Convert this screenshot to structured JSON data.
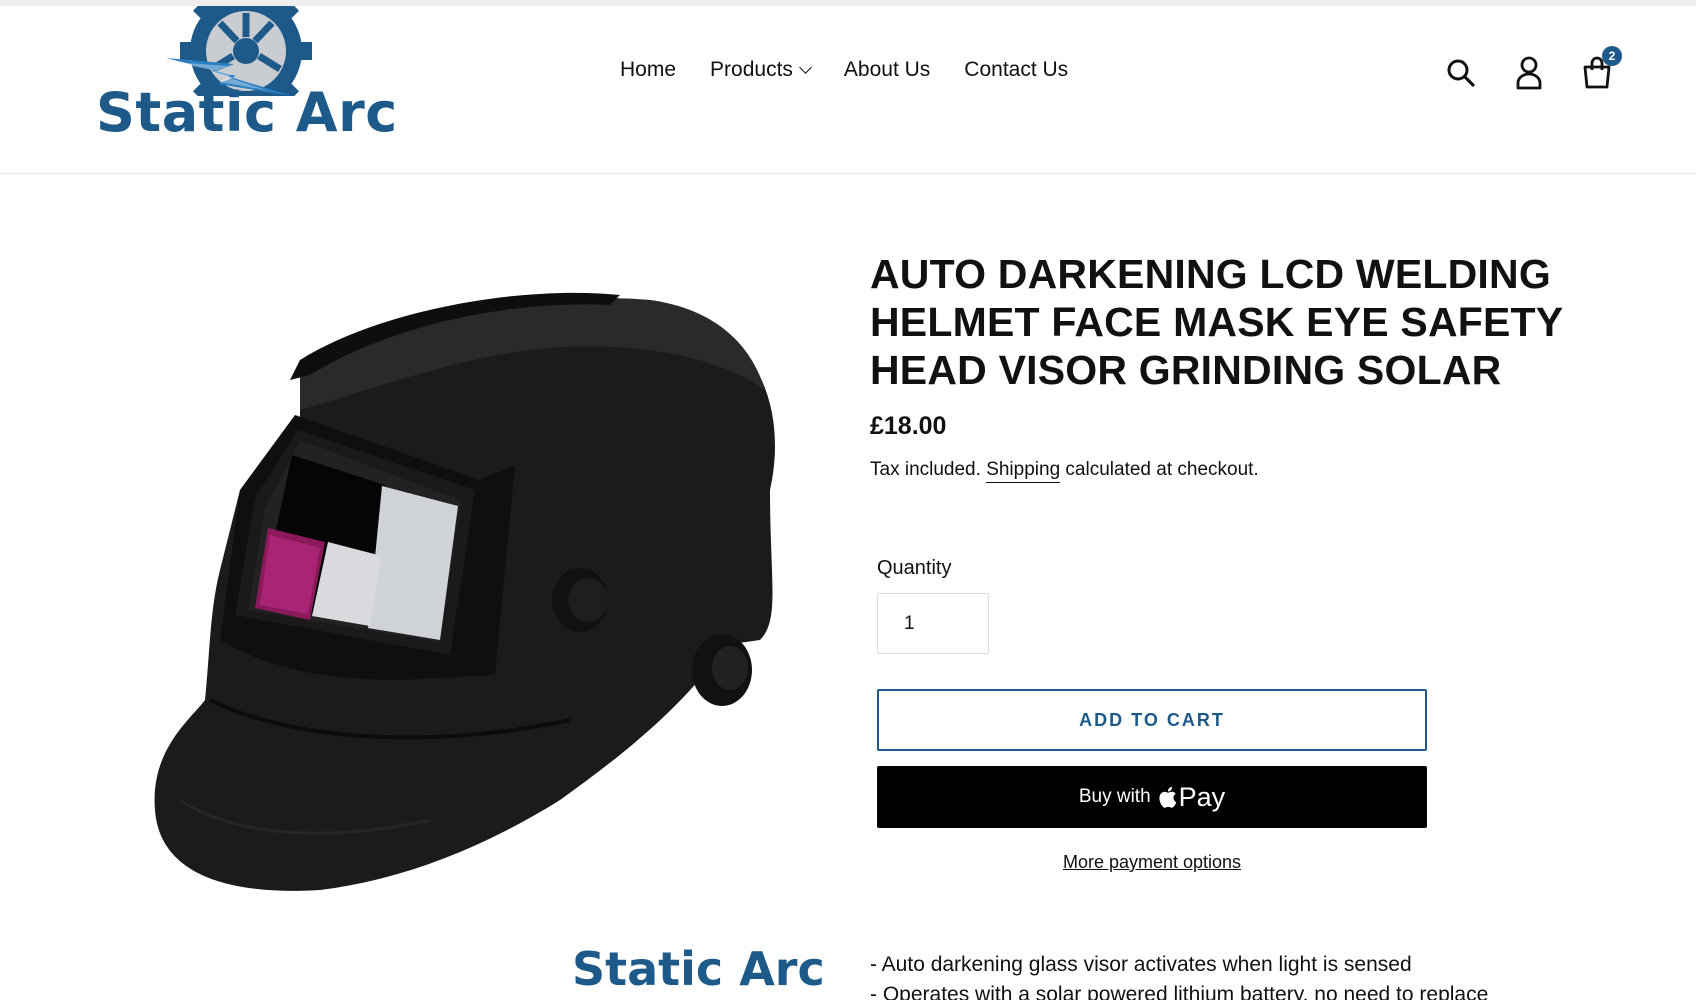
{
  "header": {
    "logo_text": "Static Arc",
    "nav": [
      {
        "label": "Home"
      },
      {
        "label": "Products"
      },
      {
        "label": "About Us"
      },
      {
        "label": "Contact Us"
      }
    ],
    "cart_count": "2",
    "icons": [
      "search-icon",
      "account-icon",
      "cart-icon"
    ]
  },
  "product": {
    "title": "AUTO DARKENING LCD WELDING HELMET FACE MASK EYE SAFETY HEAD VISOR GRINDING SOLAR",
    "price": "£18.00",
    "tax_prefix": "Tax included.",
    "shipping_link": "Shipping",
    "tax_suffix": "calculated at checkout.",
    "quantity_label": "Quantity",
    "quantity_value": "1",
    "add_to_cart": "ADD TO CART",
    "buy_with": "Buy with",
    "pay_label": "Pay",
    "more_payment": "More payment options",
    "image_watermark": "Static Arc",
    "description": [
      "- Auto darkening glass visor activates when light is sensed",
      "- Operates with a solar powered lithium battery, no need to replace"
    ]
  },
  "colors": {
    "brand": "#1d5a8a",
    "button_dark": "#000000",
    "text": "#111111"
  }
}
